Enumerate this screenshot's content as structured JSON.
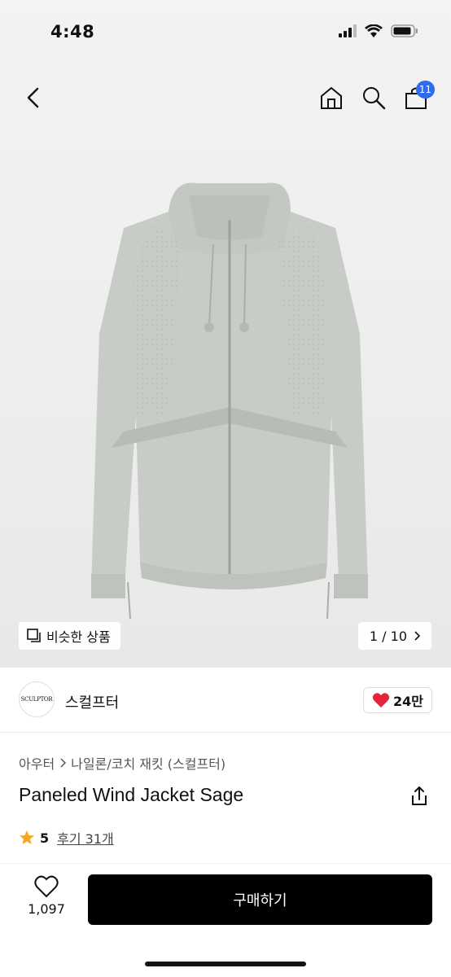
{
  "status_bar": {
    "time": "4:48"
  },
  "nav": {
    "cart_count": "11"
  },
  "gallery": {
    "similar_label": "비슷한 상품",
    "pager": "1 / 10"
  },
  "brand": {
    "logo_text": "SCULPTOR",
    "name": "스컬프터",
    "likes": "24만"
  },
  "product": {
    "breadcrumb": [
      "아우터",
      "나일론/코치 재킷 (스컬프터)"
    ],
    "title": "Paneled Wind Jacket Sage",
    "rating": "5",
    "reviews": "후기 31개"
  },
  "bottom_bar": {
    "wish_count": "1,097",
    "buy_label": "구매하기"
  },
  "colors": {
    "accent_badge": "#2f6bf0",
    "heart": "#e5243b",
    "star": "#f5a623",
    "buy_button": "#000000"
  },
  "icons": [
    "back-icon",
    "home-icon",
    "search-icon",
    "cart-icon",
    "similar-icon",
    "chevron-right-icon",
    "heart-icon",
    "share-icon",
    "star-icon",
    "heart-outline-icon"
  ]
}
